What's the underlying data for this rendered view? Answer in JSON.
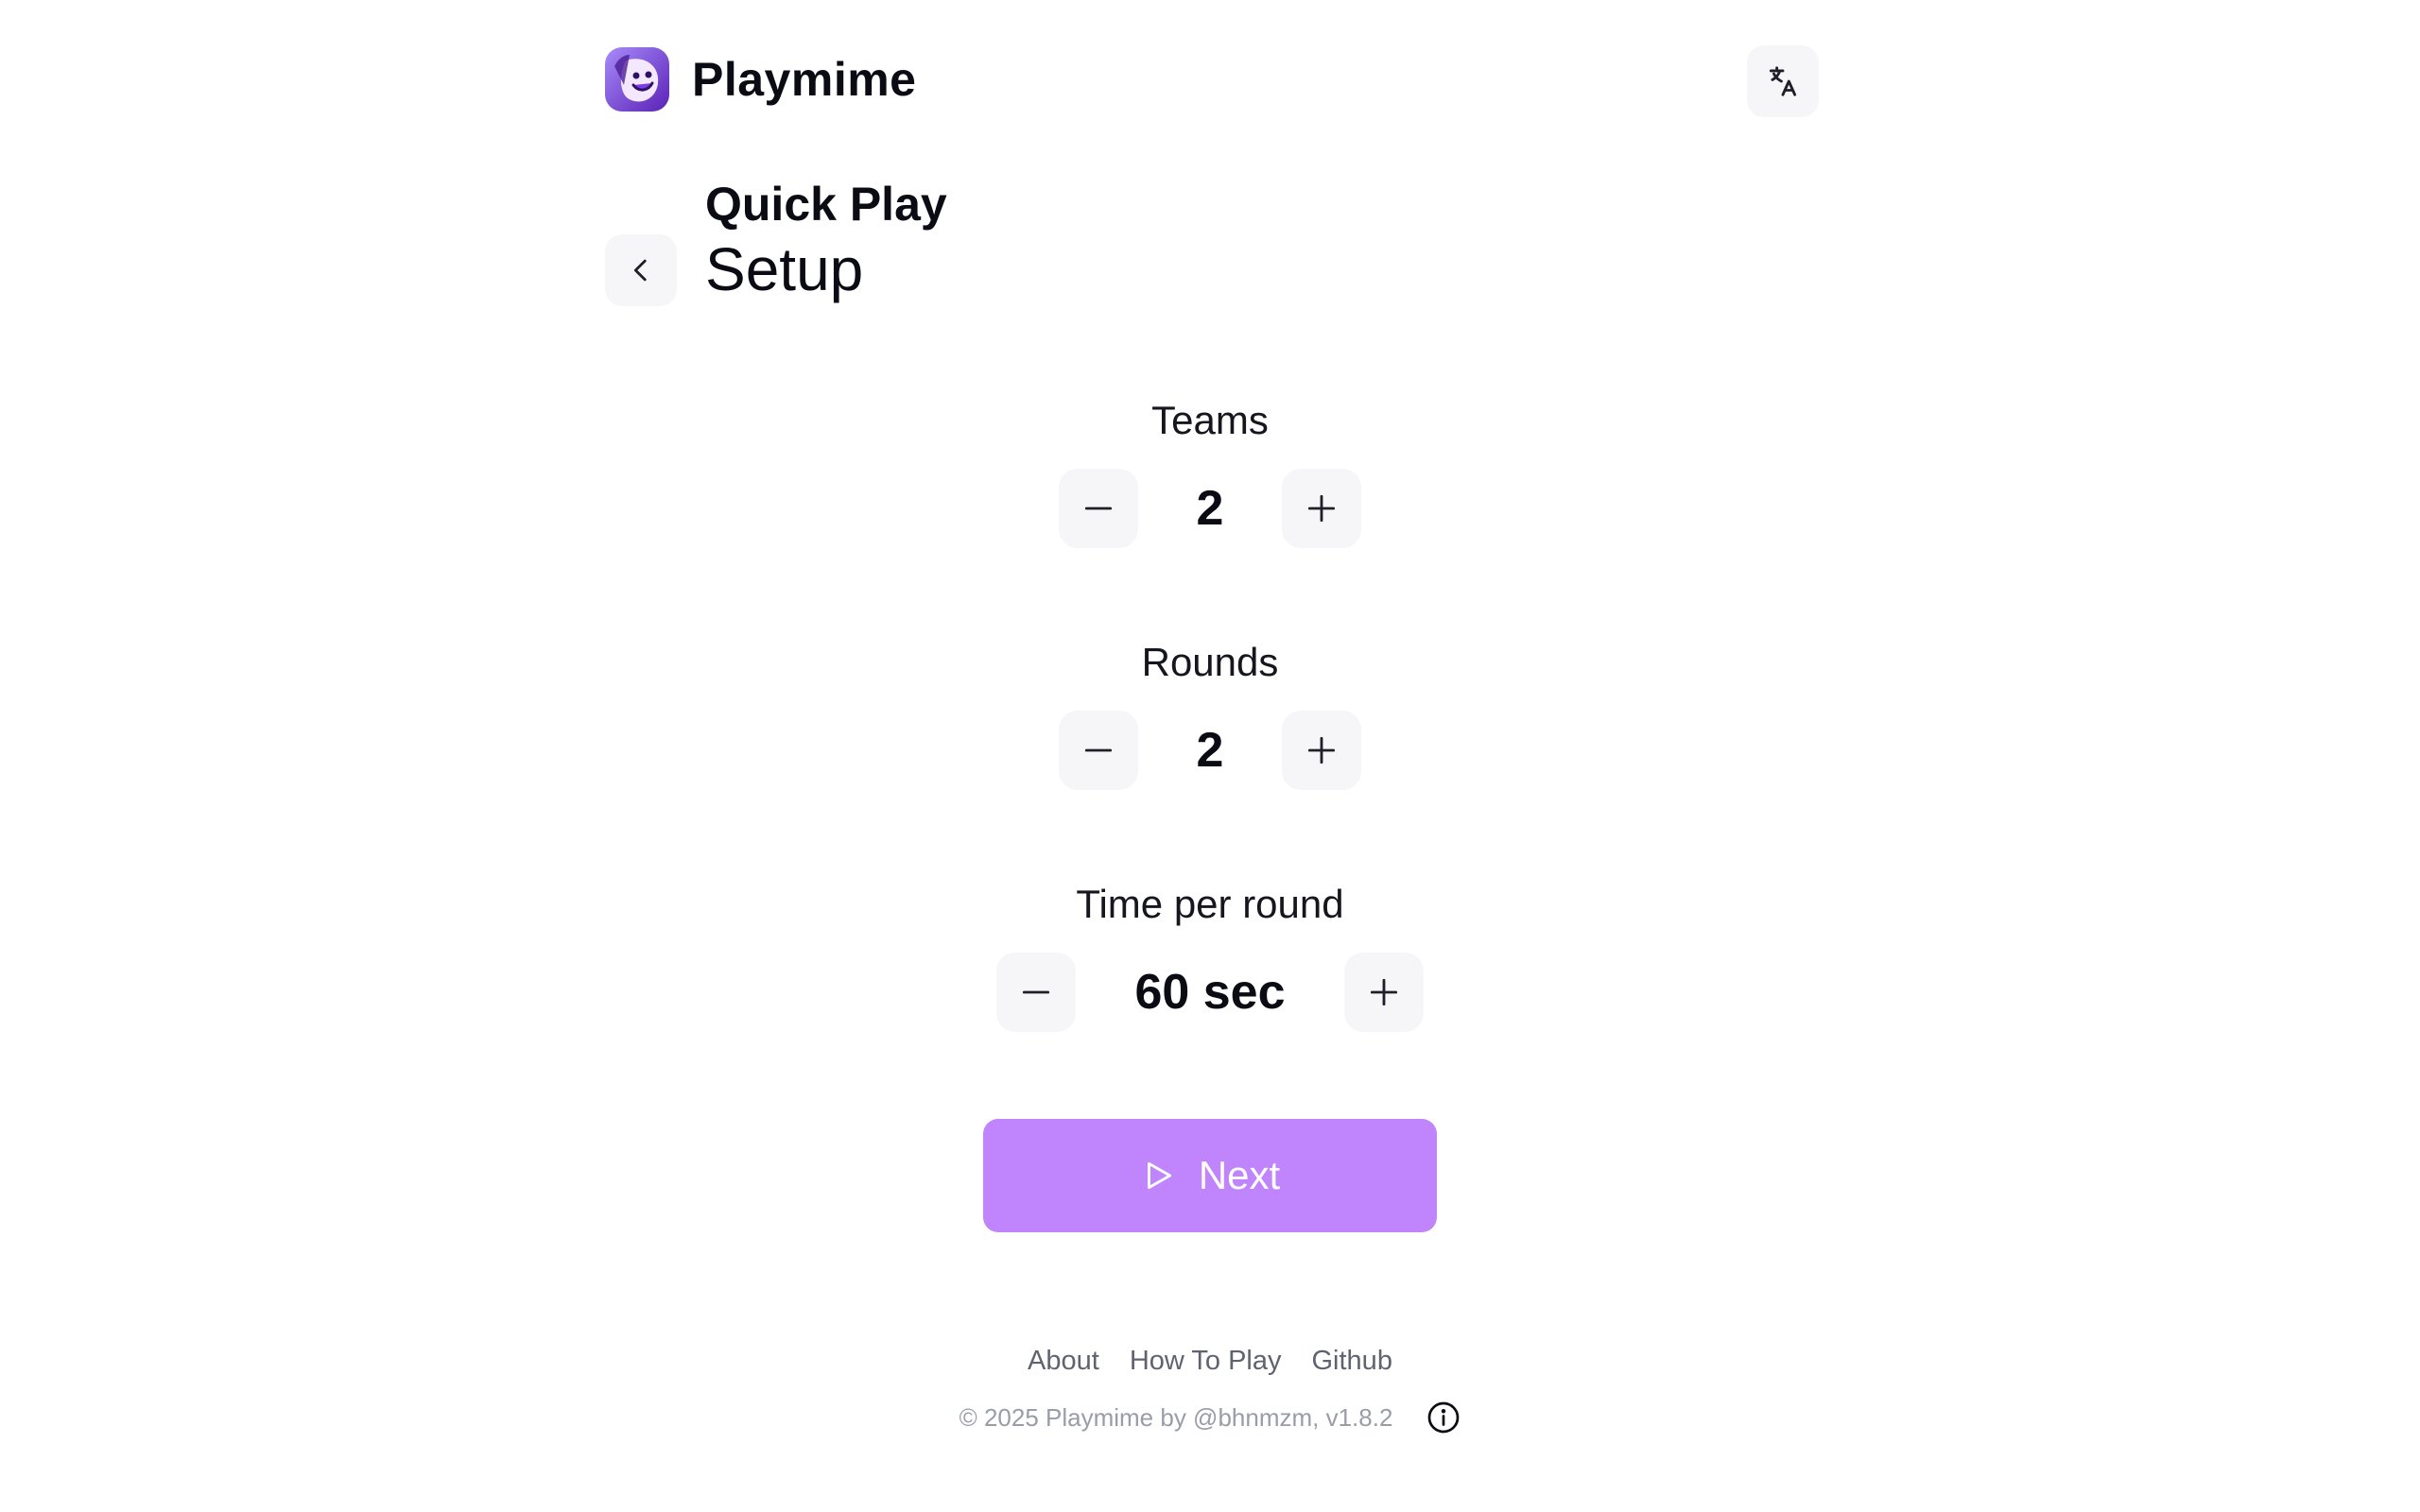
{
  "header": {
    "app_name": "Playmime",
    "logo_icon": "mime-face-logo",
    "language_icon": "translate-icon"
  },
  "page": {
    "title": "Quick Play",
    "subtitle": "Setup",
    "back_icon": "chevron-left-icon"
  },
  "settings": {
    "teams": {
      "label": "Teams",
      "value": "2"
    },
    "rounds": {
      "label": "Rounds",
      "value": "2"
    },
    "time": {
      "label": "Time per round",
      "value": "60 sec"
    }
  },
  "actions": {
    "next_label": "Next",
    "next_icon": "play-icon"
  },
  "footer": {
    "links": [
      "About",
      "How To Play",
      "Github"
    ],
    "copyright": "© 2025 Playmime by @bhnmzm, v1.8.2",
    "info_icon": "info-circle-icon"
  },
  "colors": {
    "accent": "#c084fc",
    "button_bg": "#f6f6f8",
    "text": "#0b0b14",
    "muted": "#9a9ca8"
  }
}
